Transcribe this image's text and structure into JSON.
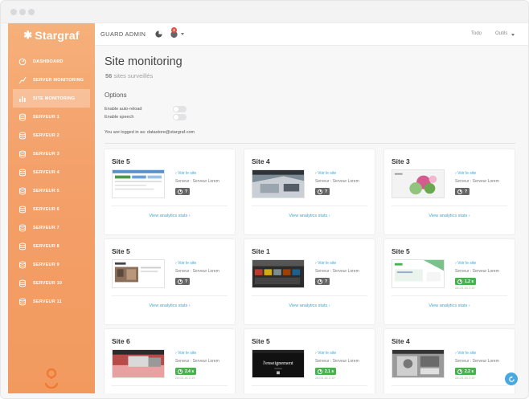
{
  "app": {
    "brand": "Stargraf"
  },
  "sidebar": {
    "items": [
      {
        "label": "DASHBOARD",
        "icon": "dashboard-icon"
      },
      {
        "label": "SERVER MONITORING",
        "icon": "trend-icon"
      },
      {
        "label": "SITE MONITORING",
        "icon": "bar-chart-icon",
        "active": true
      },
      {
        "label": "SERVEUR 1",
        "icon": "database-icon"
      },
      {
        "label": "SERVEUR 2",
        "icon": "database-icon"
      },
      {
        "label": "SERVEUR 3",
        "icon": "database-icon"
      },
      {
        "label": "SERVEUR 4",
        "icon": "database-icon"
      },
      {
        "label": "SERVEUR 5",
        "icon": "database-icon"
      },
      {
        "label": "SERVEUR 6",
        "icon": "database-icon"
      },
      {
        "label": "SERVEUR 7",
        "icon": "database-icon"
      },
      {
        "label": "SERVEUR 8",
        "icon": "database-icon"
      },
      {
        "label": "SERVEUR 9",
        "icon": "database-icon"
      },
      {
        "label": "SERVEUR 10",
        "icon": "database-icon"
      },
      {
        "label": "SERVEUR 11",
        "icon": "database-icon"
      }
    ]
  },
  "topbar": {
    "title": "GUARD ADMIN",
    "notification_count": "2",
    "todo_label": "Todo",
    "tools_label": "Outils"
  },
  "page": {
    "title": "Site monitoring",
    "subtitle_count": "56",
    "subtitle_text": "sites surveillés",
    "options_title": "Options",
    "auto_reload_label": "Enable auto-reload",
    "speech_label": "Enable speech",
    "logged_in_text": "You are logged in as: datastore@stargraf.com"
  },
  "cards": [
    {
      "title": "Site 5",
      "link": "Voir le site",
      "server": "Serveur : Serveur Lorem",
      "time": "?",
      "ok": false,
      "date": "",
      "stats": "View analytics stats",
      "thumb": "site5a"
    },
    {
      "title": "Site 4",
      "link": "Voir le site",
      "server": "Serveur : Serveur Lorem",
      "time": "?",
      "ok": false,
      "date": "",
      "stats": "View analytics stats",
      "thumb": "site4a"
    },
    {
      "title": "Site 3",
      "link": "Voir le site",
      "server": "Serveur : Serveur Lorem",
      "time": "?",
      "ok": false,
      "date": "",
      "stats": "View analytics stats",
      "thumb": "site3"
    },
    {
      "title": "Site 5",
      "link": "Voir le site",
      "server": "Serveur : Serveur Lorem",
      "time": "?",
      "ok": false,
      "date": "",
      "stats": "View analytics stats",
      "thumb": "site5b"
    },
    {
      "title": "Site 1",
      "link": "Voir le site",
      "server": "Serveur : Serveur Lorem",
      "time": "?",
      "ok": false,
      "date": "",
      "stats": "View analytics stats",
      "thumb": "site1"
    },
    {
      "title": "Site 5",
      "link": "Voir le site",
      "server": "Serveur : Serveur Lorem",
      "time": "1.2 s",
      "ok": true,
      "date": "28.03.16 2:19",
      "stats": "View analytics stats",
      "thumb": "site5c"
    },
    {
      "title": "Site 6",
      "link": "Voir le site",
      "server": "Serveur : Serveur Lorem",
      "time": "2.4 s",
      "ok": true,
      "date": "28.03.16 2:19",
      "stats": "",
      "thumb": "site6"
    },
    {
      "title": "Site 5",
      "link": "Voir le site",
      "server": "Serveur : Serveur Lorem",
      "time": "2.1 s",
      "ok": true,
      "date": "28.03.16 2:19",
      "stats": "",
      "thumb": "site5d",
      "thumb_text": "l'enseignement"
    },
    {
      "title": "Site 4",
      "link": "Voir le site",
      "server": "Serveur : Serveur Lorem",
      "time": "2.2 s",
      "ok": true,
      "date": "28.03.16 2:19",
      "stats": "",
      "thumb": "site4b"
    }
  ],
  "colors": {
    "sidebar_top": "#f6b07a",
    "sidebar_bottom": "#f29a5e",
    "link": "#3aa7de",
    "ok": "#4caf50",
    "pending": "#666666",
    "badge": "#e84a3b"
  }
}
